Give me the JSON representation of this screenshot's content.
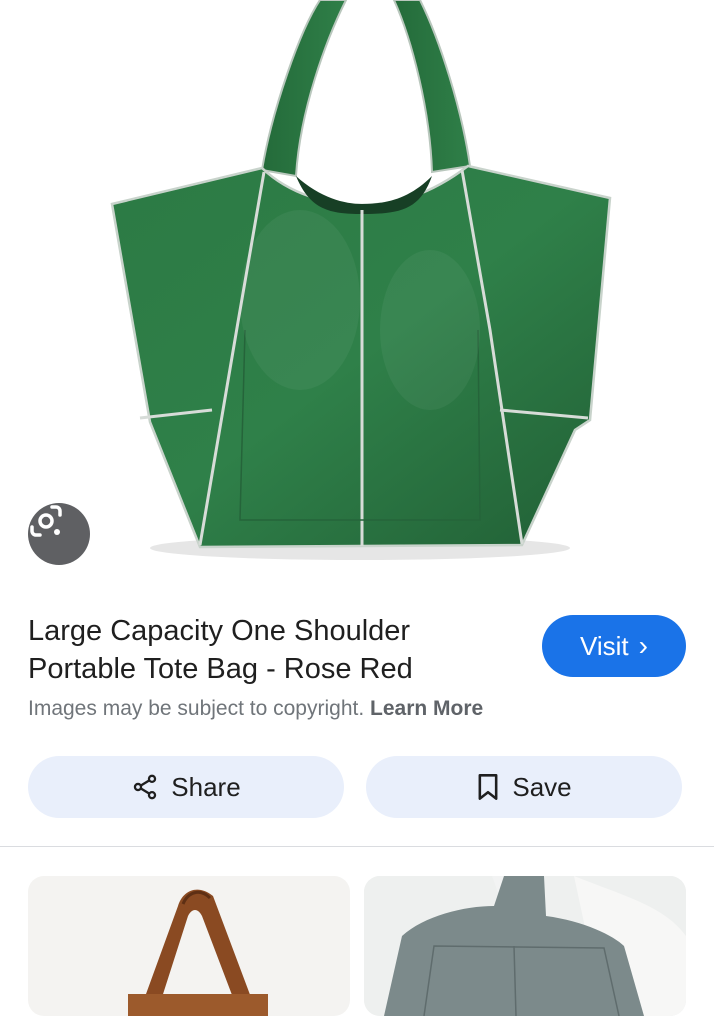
{
  "result": {
    "title_line1": "Large Capacity One Shoulder",
    "title_line2": "Portable Tote Bag - Rose Red",
    "visit_label": "Visit",
    "visit_chevron": "›",
    "copyright_text": "Images may be subject to copyright.",
    "learn_more": "Learn More"
  },
  "actions": {
    "share_label": "Share",
    "save_label": "Save"
  },
  "icons": {
    "lens": "google-lens-icon",
    "share": "share-icon",
    "save": "bookmark-icon",
    "visit": "chevron-right-icon"
  },
  "colors": {
    "accent": "#1a73e8",
    "pill_background": "#e9effb",
    "bag_green": "#2f7a45"
  }
}
